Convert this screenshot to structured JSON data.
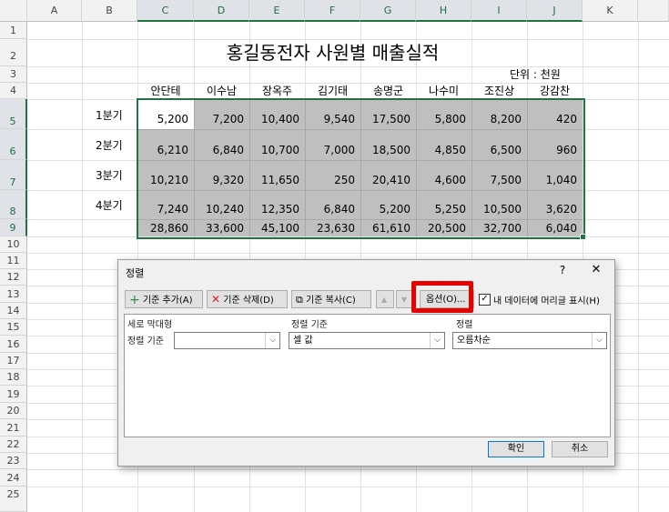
{
  "columns": [
    "A",
    "B",
    "C",
    "D",
    "E",
    "F",
    "G",
    "H",
    "I",
    "J",
    "K"
  ],
  "rows": [
    "1",
    "2",
    "3",
    "4",
    "5",
    "6",
    "7",
    "8",
    "9",
    "10",
    "11",
    "12",
    "13",
    "14",
    "15",
    "16",
    "17",
    "18",
    "19",
    "20",
    "21",
    "22",
    "23",
    "24",
    "25"
  ],
  "title": "홍길동전자 사원별 매출실적",
  "unit": "단위 : 천원",
  "names": [
    "안단테",
    "이수남",
    "장옥주",
    "김기태",
    "송명군",
    "나수미",
    "조진상",
    "강감찬"
  ],
  "quarters": [
    "1분기",
    "2분기",
    "3분기",
    "4분기"
  ],
  "table": [
    [
      "5,200",
      "7,200",
      "10,400",
      "9,540",
      "17,500",
      "5,800",
      "8,200",
      "420"
    ],
    [
      "6,210",
      "6,840",
      "10,700",
      "7,000",
      "18,500",
      "4,850",
      "6,500",
      "960"
    ],
    [
      "10,210",
      "9,320",
      "11,650",
      "250",
      "20,410",
      "4,600",
      "7,500",
      "1,040"
    ],
    [
      "7,240",
      "10,240",
      "12,350",
      "6,840",
      "5,200",
      "5,250",
      "10,500",
      "3,620"
    ],
    [
      "28,860",
      "33,600",
      "45,100",
      "23,630",
      "61,610",
      "20,500",
      "32,700",
      "6,040"
    ]
  ],
  "dialog": {
    "title": "정렬",
    "help": "?",
    "close": "✕",
    "add_level": "기준 추가(A)",
    "delete_level": "기준 삭제(D)",
    "copy_level": "기준 복사(C)",
    "move_up": "▲",
    "move_down": "▼",
    "options": "옵션(O)...",
    "header_checkbox_label": "내 데이터에 머리글 표시(H)",
    "col_header_column": "세로 막대형",
    "col_header_sort_on": "정렬 기준",
    "col_header_order": "정렬",
    "row_label": "정렬 기준",
    "sort_by_value": "",
    "sort_on_value": "셀 값",
    "order_value": "오름차순",
    "ok": "확인",
    "cancel": "취소"
  },
  "colors": {
    "accent": "#217346",
    "highlight": "#e60000",
    "shade": "#bfbfbf"
  }
}
